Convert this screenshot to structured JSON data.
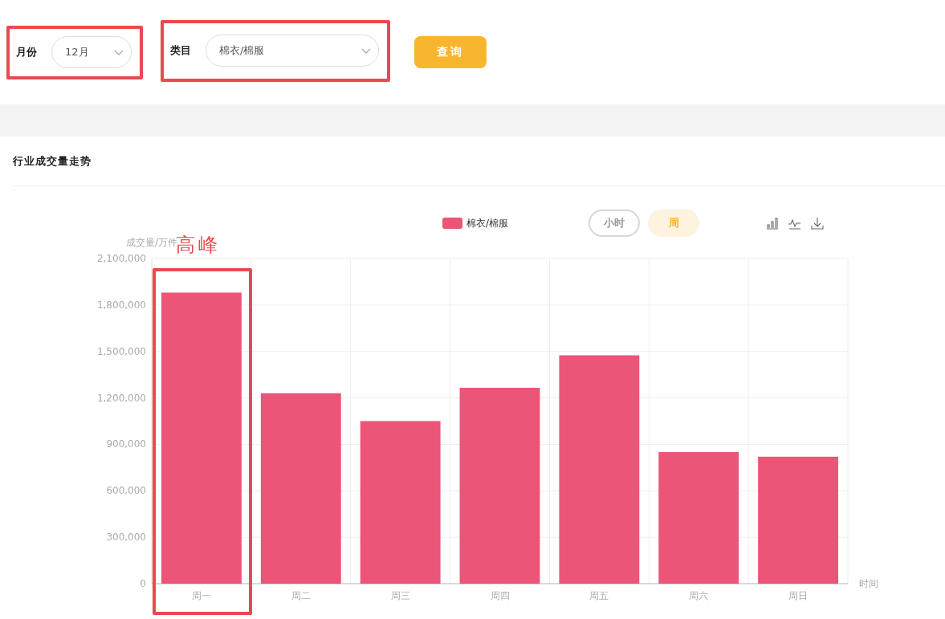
{
  "filters": [
    {
      "label": "月份",
      "value": "12月",
      "highlighted": true
    },
    {
      "label": "类目",
      "value": "棉衣/棉服",
      "highlighted": true
    }
  ],
  "query_button": "查询",
  "trend_card": {
    "title": "行业成交量走势",
    "toggles": [
      {
        "label": "小时",
        "selected": false
      },
      {
        "label": "周",
        "selected": true
      }
    ],
    "chart_data": {
      "type": "bar",
      "xlabel": "时间",
      "ylabel": "成交量/万件",
      "categories": [
        "周一",
        "周二",
        "周三",
        "周四",
        "周五",
        "周六",
        "周日"
      ],
      "series": [
        {
          "name": "棉衣/棉服",
          "color": "#eb5577",
          "values": [
            1880000,
            1230000,
            1050000,
            1265000,
            1475000,
            850000,
            820000
          ]
        }
      ],
      "ylim": [
        0,
        2100000
      ],
      "grid": true,
      "yticks": [
        0,
        {
          "value": 300000,
          "label": "300,000"
        },
        {
          "value": 600000,
          "label": "600,000"
        },
        {
          "value": 900000,
          "label": "900,000"
        },
        {
          "value": 1200000,
          "label": "1,200,000"
        },
        {
          "value": 1500000,
          "label": "1,500,000"
        },
        {
          "value": 1800000,
          "label": "1,800,000"
        },
        {
          "value": 2100000,
          "label": "2,100,000"
        }
      ]
    },
    "peak_note": {
      "text": "高峰"
    }
  }
}
